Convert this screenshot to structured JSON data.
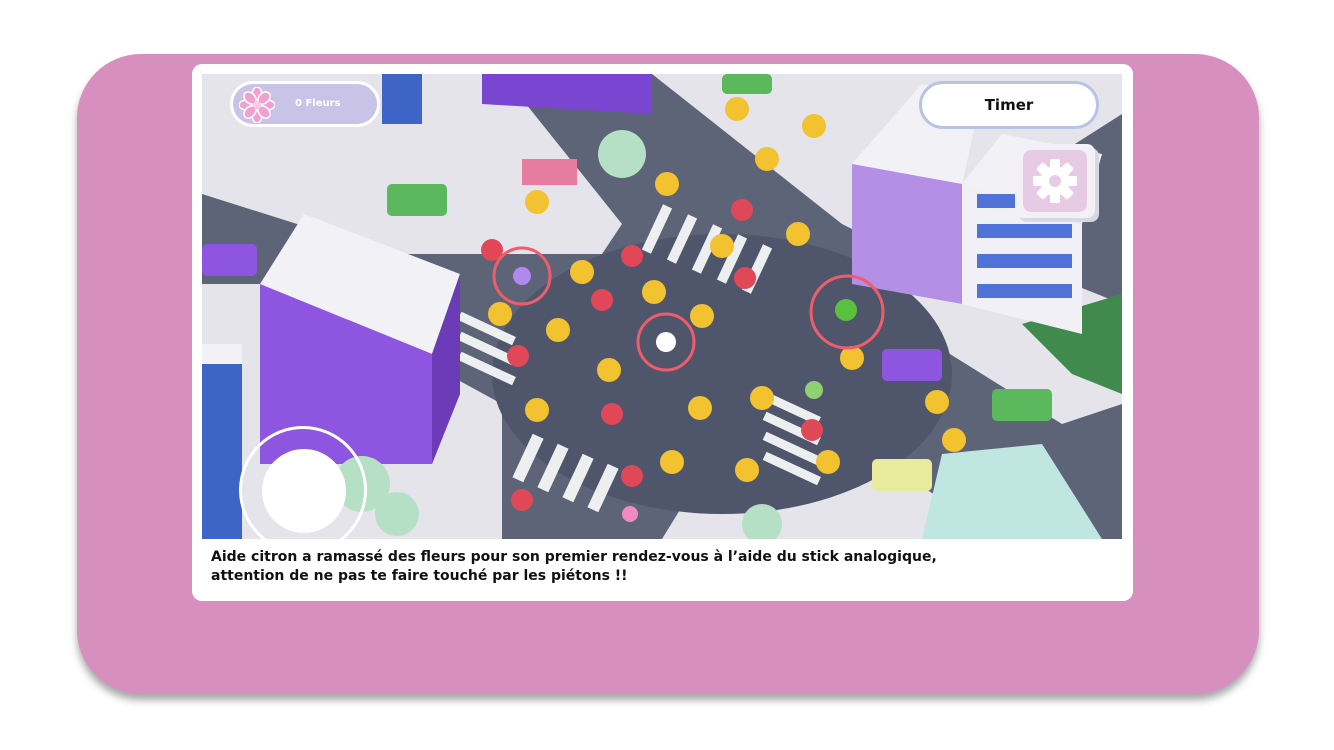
{
  "hud": {
    "flower_count": "0 Fleurs",
    "flower_icon": "flower-icon",
    "timer_label": "Timer",
    "settings_icon": "gear-icon",
    "joystick": "analog-stick"
  },
  "caption": {
    "line1": "Aide citron a ramassé des fleurs pour son premier rendez-vous à l’aide du stick analogique,",
    "line2": "attention de ne pas te faire touché par les piétons !!"
  },
  "colors": {
    "frame": "#d68fbe",
    "highlight_ring": "#ef5d6a",
    "building_purple": "#8e55e0",
    "hud_pill": "#c9c3e8"
  }
}
